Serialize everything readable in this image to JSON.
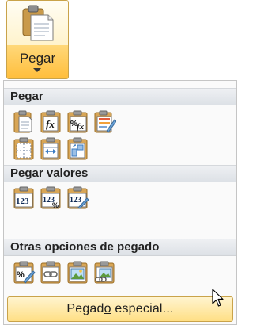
{
  "ribbon": {
    "paste_button_label": "Pegar"
  },
  "menu": {
    "sections": [
      {
        "title": "Pegar"
      },
      {
        "title": "Pegar valores"
      },
      {
        "title": "Otras opciones de pegado"
      }
    ],
    "paste_options": [
      "paste-icon",
      "paste-formulas-icon",
      "paste-formulas-number-format-icon",
      "paste-keep-source-formatting-icon",
      "paste-no-borders-icon",
      "paste-keep-column-widths-icon",
      "paste-transpose-icon"
    ],
    "value_options": [
      "paste-values-icon",
      "paste-values-number-format-icon",
      "paste-values-source-formatting-icon"
    ],
    "other_options": [
      "paste-formatting-icon",
      "paste-link-icon",
      "paste-picture-icon",
      "paste-linked-picture-icon"
    ],
    "special_label_prefix": "Pegad",
    "special_label_underlined": "o",
    "special_label_suffix": " especial..."
  },
  "colors": {
    "hover_fill": "#ffd879",
    "hover_border": "#c9a34a",
    "icon_border": "#e0a53c",
    "section_header": "#dde1e6"
  }
}
